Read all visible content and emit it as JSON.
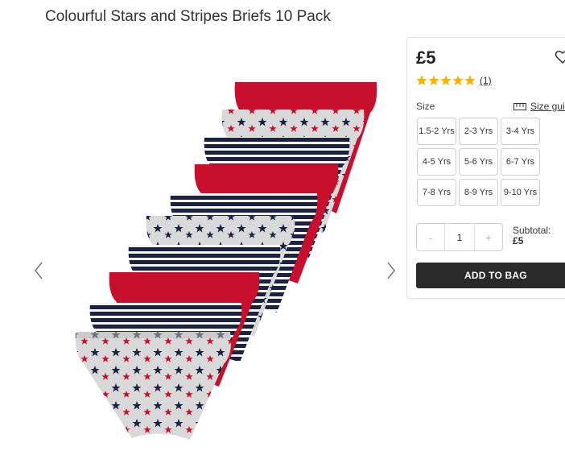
{
  "product": {
    "title": "Colourful Stars and Stripes Briefs 10 Pack",
    "price": "£5",
    "rating": 5,
    "review_count": "(1)"
  },
  "size_section": {
    "label": "Size",
    "guide_label": "Size guide",
    "options": [
      "1.5-2 Yrs",
      "2-3 Yrs",
      "3-4 Yrs",
      "4-5 Yrs",
      "5-6 Yrs",
      "6-7 Yrs",
      "7-8 Yrs",
      "8-9 Yrs",
      "9-10 Yrs"
    ]
  },
  "quantity": {
    "minus": "-",
    "value": "1",
    "plus": "+"
  },
  "subtotal": {
    "label": "Subtotal:",
    "value": "£5"
  },
  "add_to_bag_label": "ADD TO BAG",
  "colors": {
    "star": "#f4b400",
    "button": "#2a2a2a",
    "red": "#c8102e",
    "navy": "#1c2340",
    "grey": "#d9d9d9"
  },
  "icons": [
    "chevron-left-icon",
    "chevron-right-icon",
    "heart-icon",
    "star-icon",
    "ruler-icon"
  ]
}
